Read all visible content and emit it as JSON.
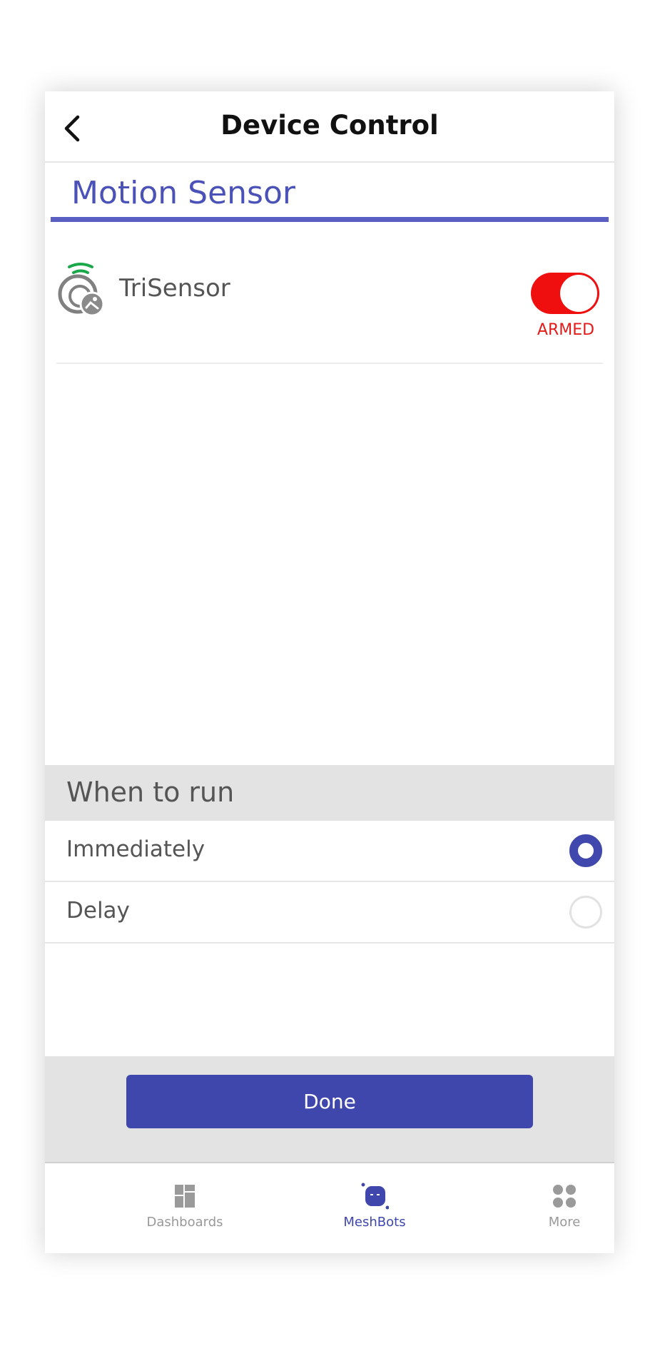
{
  "header": {
    "title": "Device Control"
  },
  "section": {
    "title": "Motion Sensor"
  },
  "device": {
    "name": "TriSensor",
    "toggle_state_label": "ARMED",
    "toggle_on": true
  },
  "when_to_run": {
    "title": "When to run",
    "options": [
      {
        "label": "Immediately",
        "selected": true
      },
      {
        "label": "Delay",
        "selected": false
      }
    ]
  },
  "done": {
    "label": "Done"
  },
  "nav": {
    "items": [
      {
        "label": "Dashboards",
        "active": false
      },
      {
        "label": "MeshBots",
        "active": true
      },
      {
        "label": "More",
        "active": false
      }
    ]
  },
  "colors": {
    "accent": "#3f47ad",
    "section_title": "#4a52b8",
    "armed_red": "#f00f0f",
    "signal_green": "#1aa84a"
  }
}
